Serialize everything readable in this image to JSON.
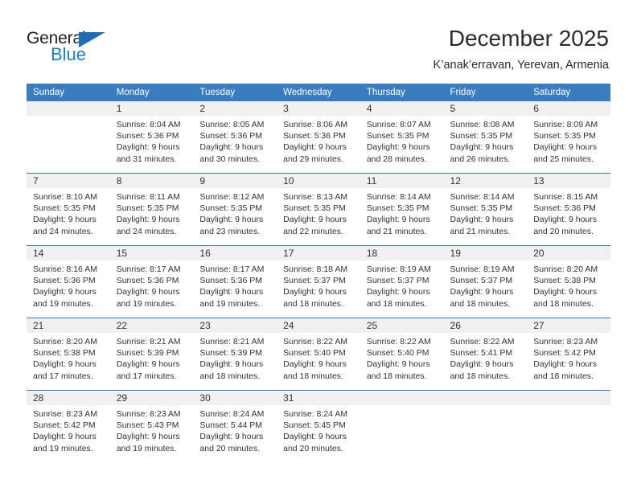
{
  "brand": {
    "name_primary": "General",
    "name_secondary": "Blue",
    "accent_color": "#1f7cc6",
    "header_color": "#3a7cc0"
  },
  "header": {
    "title": "December 2025",
    "subtitle": "K’anak’erravan, Yerevan, Armenia"
  },
  "weekday_headers": [
    "Sunday",
    "Monday",
    "Tuesday",
    "Wednesday",
    "Thursday",
    "Friday",
    "Saturday"
  ],
  "weeks": [
    [
      {
        "day": "",
        "blank": true,
        "sunrise": "",
        "sunset": "",
        "daylight_line1": "",
        "daylight_line2": ""
      },
      {
        "day": "1",
        "blank": false,
        "sunrise": "Sunrise: 8:04 AM",
        "sunset": "Sunset: 5:36 PM",
        "daylight_line1": "Daylight: 9 hours",
        "daylight_line2": "and 31 minutes."
      },
      {
        "day": "2",
        "blank": false,
        "sunrise": "Sunrise: 8:05 AM",
        "sunset": "Sunset: 5:36 PM",
        "daylight_line1": "Daylight: 9 hours",
        "daylight_line2": "and 30 minutes."
      },
      {
        "day": "3",
        "blank": false,
        "sunrise": "Sunrise: 8:06 AM",
        "sunset": "Sunset: 5:36 PM",
        "daylight_line1": "Daylight: 9 hours",
        "daylight_line2": "and 29 minutes."
      },
      {
        "day": "4",
        "blank": false,
        "sunrise": "Sunrise: 8:07 AM",
        "sunset": "Sunset: 5:35 PM",
        "daylight_line1": "Daylight: 9 hours",
        "daylight_line2": "and 28 minutes."
      },
      {
        "day": "5",
        "blank": false,
        "sunrise": "Sunrise: 8:08 AM",
        "sunset": "Sunset: 5:35 PM",
        "daylight_line1": "Daylight: 9 hours",
        "daylight_line2": "and 26 minutes."
      },
      {
        "day": "6",
        "blank": false,
        "sunrise": "Sunrise: 8:09 AM",
        "sunset": "Sunset: 5:35 PM",
        "daylight_line1": "Daylight: 9 hours",
        "daylight_line2": "and 25 minutes."
      }
    ],
    [
      {
        "day": "7",
        "blank": false,
        "sunrise": "Sunrise: 8:10 AM",
        "sunset": "Sunset: 5:35 PM",
        "daylight_line1": "Daylight: 9 hours",
        "daylight_line2": "and 24 minutes."
      },
      {
        "day": "8",
        "blank": false,
        "sunrise": "Sunrise: 8:11 AM",
        "sunset": "Sunset: 5:35 PM",
        "daylight_line1": "Daylight: 9 hours",
        "daylight_line2": "and 24 minutes."
      },
      {
        "day": "9",
        "blank": false,
        "sunrise": "Sunrise: 8:12 AM",
        "sunset": "Sunset: 5:35 PM",
        "daylight_line1": "Daylight: 9 hours",
        "daylight_line2": "and 23 minutes."
      },
      {
        "day": "10",
        "blank": false,
        "sunrise": "Sunrise: 8:13 AM",
        "sunset": "Sunset: 5:35 PM",
        "daylight_line1": "Daylight: 9 hours",
        "daylight_line2": "and 22 minutes."
      },
      {
        "day": "11",
        "blank": false,
        "sunrise": "Sunrise: 8:14 AM",
        "sunset": "Sunset: 5:35 PM",
        "daylight_line1": "Daylight: 9 hours",
        "daylight_line2": "and 21 minutes."
      },
      {
        "day": "12",
        "blank": false,
        "sunrise": "Sunrise: 8:14 AM",
        "sunset": "Sunset: 5:35 PM",
        "daylight_line1": "Daylight: 9 hours",
        "daylight_line2": "and 21 minutes."
      },
      {
        "day": "13",
        "blank": false,
        "sunrise": "Sunrise: 8:15 AM",
        "sunset": "Sunset: 5:36 PM",
        "daylight_line1": "Daylight: 9 hours",
        "daylight_line2": "and 20 minutes."
      }
    ],
    [
      {
        "day": "14",
        "blank": false,
        "sunrise": "Sunrise: 8:16 AM",
        "sunset": "Sunset: 5:36 PM",
        "daylight_line1": "Daylight: 9 hours",
        "daylight_line2": "and 19 minutes."
      },
      {
        "day": "15",
        "blank": false,
        "sunrise": "Sunrise: 8:17 AM",
        "sunset": "Sunset: 5:36 PM",
        "daylight_line1": "Daylight: 9 hours",
        "daylight_line2": "and 19 minutes."
      },
      {
        "day": "16",
        "blank": false,
        "sunrise": "Sunrise: 8:17 AM",
        "sunset": "Sunset: 5:36 PM",
        "daylight_line1": "Daylight: 9 hours",
        "daylight_line2": "and 19 minutes."
      },
      {
        "day": "17",
        "blank": false,
        "sunrise": "Sunrise: 8:18 AM",
        "sunset": "Sunset: 5:37 PM",
        "daylight_line1": "Daylight: 9 hours",
        "daylight_line2": "and 18 minutes."
      },
      {
        "day": "18",
        "blank": false,
        "sunrise": "Sunrise: 8:19 AM",
        "sunset": "Sunset: 5:37 PM",
        "daylight_line1": "Daylight: 9 hours",
        "daylight_line2": "and 18 minutes."
      },
      {
        "day": "19",
        "blank": false,
        "sunrise": "Sunrise: 8:19 AM",
        "sunset": "Sunset: 5:37 PM",
        "daylight_line1": "Daylight: 9 hours",
        "daylight_line2": "and 18 minutes."
      },
      {
        "day": "20",
        "blank": false,
        "sunrise": "Sunrise: 8:20 AM",
        "sunset": "Sunset: 5:38 PM",
        "daylight_line1": "Daylight: 9 hours",
        "daylight_line2": "and 18 minutes."
      }
    ],
    [
      {
        "day": "21",
        "blank": false,
        "sunrise": "Sunrise: 8:20 AM",
        "sunset": "Sunset: 5:38 PM",
        "daylight_line1": "Daylight: 9 hours",
        "daylight_line2": "and 17 minutes."
      },
      {
        "day": "22",
        "blank": false,
        "sunrise": "Sunrise: 8:21 AM",
        "sunset": "Sunset: 5:39 PM",
        "daylight_line1": "Daylight: 9 hours",
        "daylight_line2": "and 17 minutes."
      },
      {
        "day": "23",
        "blank": false,
        "sunrise": "Sunrise: 8:21 AM",
        "sunset": "Sunset: 5:39 PM",
        "daylight_line1": "Daylight: 9 hours",
        "daylight_line2": "and 18 minutes."
      },
      {
        "day": "24",
        "blank": false,
        "sunrise": "Sunrise: 8:22 AM",
        "sunset": "Sunset: 5:40 PM",
        "daylight_line1": "Daylight: 9 hours",
        "daylight_line2": "and 18 minutes."
      },
      {
        "day": "25",
        "blank": false,
        "sunrise": "Sunrise: 8:22 AM",
        "sunset": "Sunset: 5:40 PM",
        "daylight_line1": "Daylight: 9 hours",
        "daylight_line2": "and 18 minutes."
      },
      {
        "day": "26",
        "blank": false,
        "sunrise": "Sunrise: 8:22 AM",
        "sunset": "Sunset: 5:41 PM",
        "daylight_line1": "Daylight: 9 hours",
        "daylight_line2": "and 18 minutes."
      },
      {
        "day": "27",
        "blank": false,
        "sunrise": "Sunrise: 8:23 AM",
        "sunset": "Sunset: 5:42 PM",
        "daylight_line1": "Daylight: 9 hours",
        "daylight_line2": "and 18 minutes."
      }
    ],
    [
      {
        "day": "28",
        "blank": false,
        "sunrise": "Sunrise: 8:23 AM",
        "sunset": "Sunset: 5:42 PM",
        "daylight_line1": "Daylight: 9 hours",
        "daylight_line2": "and 19 minutes."
      },
      {
        "day": "29",
        "blank": false,
        "sunrise": "Sunrise: 8:23 AM",
        "sunset": "Sunset: 5:43 PM",
        "daylight_line1": "Daylight: 9 hours",
        "daylight_line2": "and 19 minutes."
      },
      {
        "day": "30",
        "blank": false,
        "sunrise": "Sunrise: 8:24 AM",
        "sunset": "Sunset: 5:44 PM",
        "daylight_line1": "Daylight: 9 hours",
        "daylight_line2": "and 20 minutes."
      },
      {
        "day": "31",
        "blank": false,
        "sunrise": "Sunrise: 8:24 AM",
        "sunset": "Sunset: 5:45 PM",
        "daylight_line1": "Daylight: 9 hours",
        "daylight_line2": "and 20 minutes."
      },
      {
        "day": "",
        "blank": true,
        "sunrise": "",
        "sunset": "",
        "daylight_line1": "",
        "daylight_line2": ""
      },
      {
        "day": "",
        "blank": true,
        "sunrise": "",
        "sunset": "",
        "daylight_line1": "",
        "daylight_line2": ""
      },
      {
        "day": "",
        "blank": true,
        "sunrise": "",
        "sunset": "",
        "daylight_line1": "",
        "daylight_line2": ""
      }
    ]
  ]
}
